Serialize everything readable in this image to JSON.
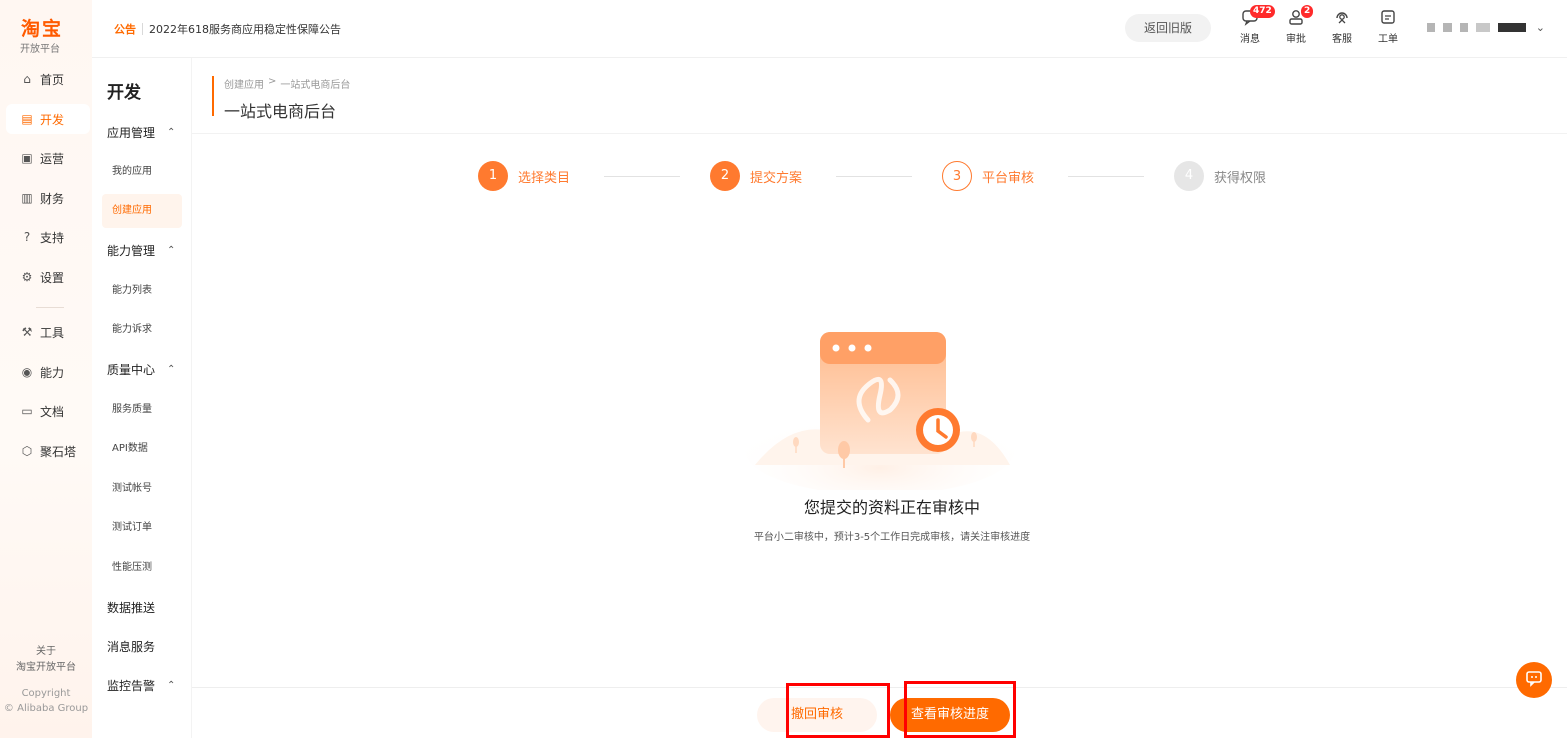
{
  "logo": {
    "main": "淘宝",
    "sub": "开放平台"
  },
  "primary_nav": [
    {
      "label": "首页",
      "icon": "home-icon",
      "glyph": "⌂",
      "active": false
    },
    {
      "label": "开发",
      "icon": "code-icon",
      "glyph": "▤",
      "active": true
    },
    {
      "label": "运营",
      "icon": "chart-icon",
      "glyph": "▣",
      "active": false
    },
    {
      "label": "财务",
      "icon": "finance-icon",
      "glyph": "▥",
      "active": false
    },
    {
      "label": "支持",
      "icon": "support-icon",
      "glyph": "?",
      "active": false
    },
    {
      "label": "设置",
      "icon": "settings-icon",
      "glyph": "⚙",
      "active": false
    },
    {
      "label": "工具",
      "icon": "tool-icon",
      "glyph": "⚒",
      "active": false
    },
    {
      "label": "能力",
      "icon": "ability-icon",
      "glyph": "◉",
      "active": false
    },
    {
      "label": "文档",
      "icon": "folder-icon",
      "glyph": "▭",
      "active": false
    },
    {
      "label": "聚石塔",
      "icon": "cube-icon",
      "glyph": "⬡",
      "active": false
    }
  ],
  "about": {
    "line1": "关于",
    "line2": "淘宝开放平台"
  },
  "copyright": {
    "line1": "Copyright",
    "line2": "© Alibaba Group"
  },
  "header": {
    "notice_tag": "公告",
    "notice_text": "2022年618服务商应用稳定性保障公告",
    "back_old": "返回旧版",
    "icons": [
      {
        "label": "消息",
        "icon": "message-icon",
        "glyph": "💬",
        "badge": "472"
      },
      {
        "label": "审批",
        "icon": "approval-icon",
        "glyph": "⚲",
        "badge": "2"
      },
      {
        "label": "客服",
        "icon": "headset-icon",
        "glyph": "☊",
        "badge": ""
      },
      {
        "label": "工单",
        "icon": "ticket-icon",
        "glyph": "✎",
        "badge": ""
      }
    ]
  },
  "subnav": {
    "title": "开发",
    "groups": [
      {
        "label": "应用管理",
        "caret": "⌃"
      },
      {
        "label": "能力管理",
        "caret": "⌃"
      },
      {
        "label": "质量中心",
        "caret": "⌃"
      },
      {
        "label": "数据推送",
        "caret": ""
      },
      {
        "label": "消息服务",
        "caret": ""
      },
      {
        "label": "监控告警",
        "caret": "⌃"
      }
    ],
    "items": [
      {
        "label": "我的应用",
        "active": false
      },
      {
        "label": "创建应用",
        "active": true
      },
      {
        "label": "能力列表",
        "active": false
      },
      {
        "label": "能力诉求",
        "active": false
      },
      {
        "label": "服务质量",
        "active": false
      },
      {
        "label": "API数据",
        "active": false
      },
      {
        "label": "测试帐号",
        "active": false
      },
      {
        "label": "测试订单",
        "active": false
      },
      {
        "label": "性能压测",
        "active": false
      }
    ]
  },
  "breadcrumb": {
    "parent": "创建应用",
    "sep": ">",
    "current": "一站式电商后台"
  },
  "page_title": "一站式电商后台",
  "steps": [
    {
      "num": "1",
      "label": "选择类目",
      "state": "done"
    },
    {
      "num": "2",
      "label": "提交方案",
      "state": "done"
    },
    {
      "num": "3",
      "label": "平台审核",
      "state": "current"
    },
    {
      "num": "4",
      "label": "获得权限",
      "state": "todo"
    }
  ],
  "status": {
    "title": "您提交的资料正在审核中",
    "desc": "平台小二审核中，预计3-5个工作日完成审核，请关注审核进度"
  },
  "buttons": {
    "withdraw": "撤回审核",
    "progress": "查看审核进度"
  },
  "colors": {
    "brand": "#ff6a00",
    "step_done": "#ff7a2f",
    "highlight_box": "#ff0000"
  }
}
